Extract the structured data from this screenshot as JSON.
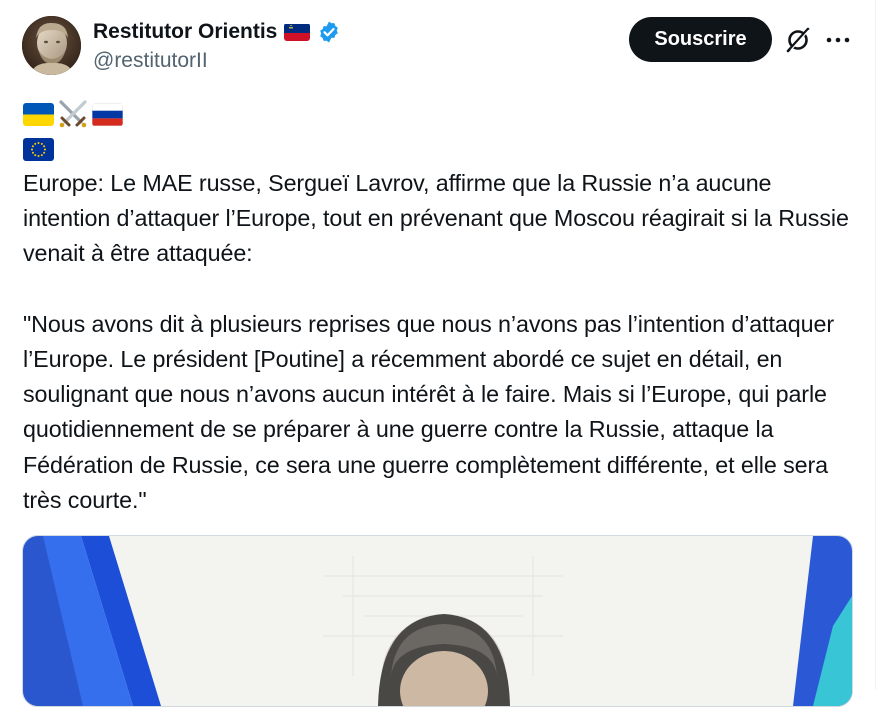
{
  "author": {
    "display_name": "Restitutor Orientis",
    "handle": "@restitutorII",
    "name_flag": "liechtenstein-flag",
    "verified": true,
    "verified_color": "#1d9bf0"
  },
  "actions": {
    "subscribe_label": "Souscrire",
    "grok_icon": "grok-icon",
    "more_icon": "more-icon"
  },
  "emoji_lines": [
    [
      "ukraine-flag",
      "crossed-swords",
      "russia-flag"
    ],
    [
      "eu-flag"
    ]
  ],
  "tweet": {
    "text": "Europe: Le MAE russe, Sergueï Lavrov, affirme que la Russie n’a aucune intention d’attaquer l’Europe, tout en prévenant que Moscou réagirait si la Russie venait à être attaquée:\n\n\"Nous avons dit à plusieurs reprises que nous n’avons pas l’intention d’attaquer l’Europe. Le président [Poutine] a récemment abordé ce sujet en détail, en soulignant que nous n’avons aucun intérêt à le faire. Mais si l’Europe, qui parle quotidiennement de se préparer à une guerre contre la Russie, attaque la Fédération de Russie, ce sera une guerre complètement différente, et elle sera très courte.\""
  },
  "media": {
    "description_icon": "photo-of-speaker-with-russian-flag"
  },
  "colors": {
    "primary_text": "#0f1419",
    "secondary_text": "#536471",
    "button_bg": "#0f1419",
    "border": "#cfd9de"
  }
}
